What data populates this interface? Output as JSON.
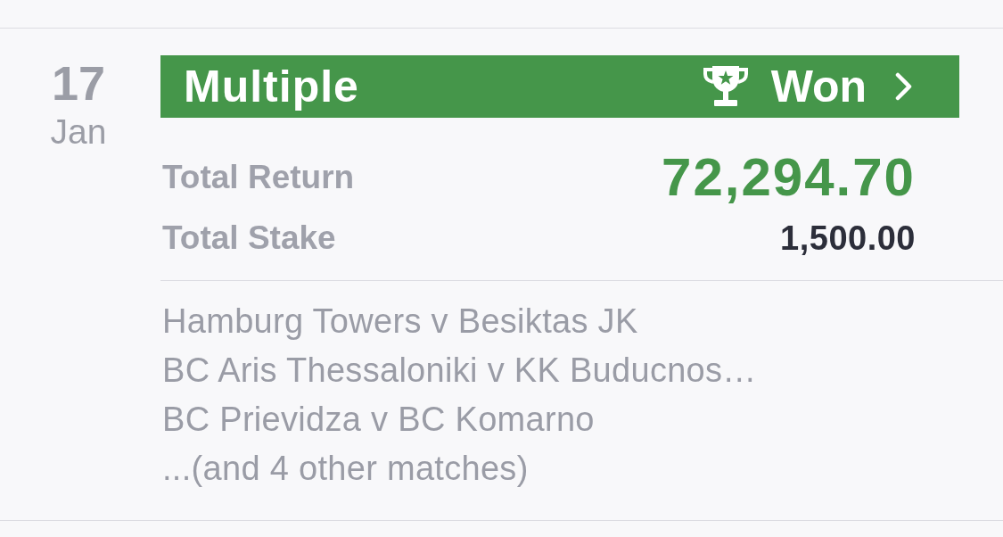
{
  "date": {
    "day": "17",
    "month": "Jan"
  },
  "bet": {
    "type": "Multiple",
    "status": {
      "label": "Won",
      "kind": "won"
    }
  },
  "totals": [
    {
      "label": "Total Return",
      "value": "72,294.70",
      "kind": "return"
    },
    {
      "label": "Total Stake",
      "value": "1,500.00",
      "kind": "stake"
    }
  ],
  "matches": [
    "Hamburg Towers v Besiktas JK",
    "BC Aris Thessaloniki v KK Buducnos…",
    "BC Prievidza v BC Komarno",
    "...(and 4 other matches)"
  ]
}
